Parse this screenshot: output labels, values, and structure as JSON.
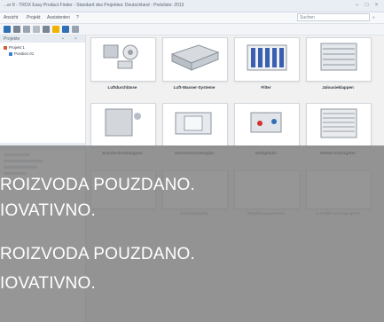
{
  "window": {
    "title": "...er 8 - TROX Easy Product Finder - Standard des Projektes: Deutschland - Preisliste: 2013",
    "buttons": [
      "minimize-icon",
      "maximize-icon",
      "close-icon"
    ]
  },
  "menu": {
    "items": [
      "Ansicht",
      "Projekt",
      "Assistenten",
      "?"
    ],
    "search_placeholder": "Suchen"
  },
  "toolbar": {
    "icons": [
      "save-icon",
      "open-icon",
      "print-icon",
      "copy-icon",
      "view-icon",
      "highlight-icon",
      "filter-icon",
      "list-icon"
    ],
    "colors": {
      "accent": "#f0b400",
      "blue": "#2f6fb8",
      "gray": "#7a8594"
    }
  },
  "left_panel": {
    "title": "Projekte",
    "tree": [
      {
        "label": "Projekt 1"
      },
      {
        "label": "Position 01"
      }
    ]
  },
  "products": [
    {
      "label": "Luftdurchlässe"
    },
    {
      "label": "Luft-Wasser-Systeme"
    },
    {
      "label": "Filter"
    },
    {
      "label": "Jalousieklappen"
    },
    {
      "label": "Brandschutzklappen"
    },
    {
      "label": "Volumenstromregler"
    },
    {
      "label": "Stellglieder"
    },
    {
      "label": "Wetterschutzgitter"
    },
    {
      "label": "Schalldämpfer"
    },
    {
      "label": "Regelkomponenten"
    },
    {
      "label": "X-CUBE Lüftungsgerät"
    }
  ],
  "overlay": {
    "lines": [
      "ROIZVODA POUZDANO.",
      "IOVATIVNO.",
      "ROIZVODA POUZDANO.",
      "IOVATIVNO."
    ],
    "color": "#787878"
  }
}
